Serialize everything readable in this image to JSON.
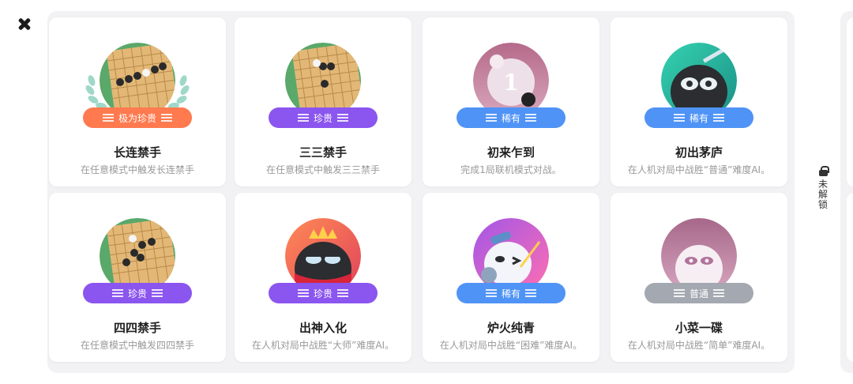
{
  "close": {
    "icon": "close-icon"
  },
  "cards": [
    {
      "title": "长连禁手",
      "desc": "在任意模式中触发长连禁手",
      "rarity": "极为珍贵",
      "rarity_color": "#ff7a4f",
      "medal": "gomoku-board"
    },
    {
      "title": "三三禁手",
      "desc": "在任意模式中触发三三禁手",
      "rarity": "珍贵",
      "rarity_color": "#8b55ef",
      "medal": "gomoku-board"
    },
    {
      "title": "初来乍到",
      "desc": "完成1局联机模式对战。",
      "rarity": "稀有",
      "rarity_color": "#4f93f6",
      "medal": "number-one"
    },
    {
      "title": "初出茅庐",
      "desc": "在人机对局中战胜“普通”难度AI。",
      "rarity": "稀有",
      "rarity_color": "#4f93f6",
      "medal": "robot-sword"
    },
    {
      "title": "四四禁手",
      "desc": "在任意模式中触发四四禁手",
      "rarity": "珍贵",
      "rarity_color": "#8b55ef",
      "medal": "gomoku-board"
    },
    {
      "title": "出神入化",
      "desc": "在人机对局中战胜“大师”难度AI。",
      "rarity": "珍贵",
      "rarity_color": "#8b55ef",
      "medal": "robot-king"
    },
    {
      "title": "炉火纯青",
      "desc": "在人机对局中战胜“困难”难度AI。",
      "rarity": "稀有",
      "rarity_color": "#4f93f6",
      "medal": "robot-wink"
    },
    {
      "title": "小菜一碟",
      "desc": "在人机对局中战胜“简单”难度AI。",
      "rarity": "普通",
      "rarity_color": "#a4a8b0",
      "medal": "robot-simple"
    }
  ],
  "locked_hint": {
    "icon": "lock-icon",
    "label": "未解锁",
    "chars": [
      "未",
      "解",
      "锁"
    ]
  }
}
